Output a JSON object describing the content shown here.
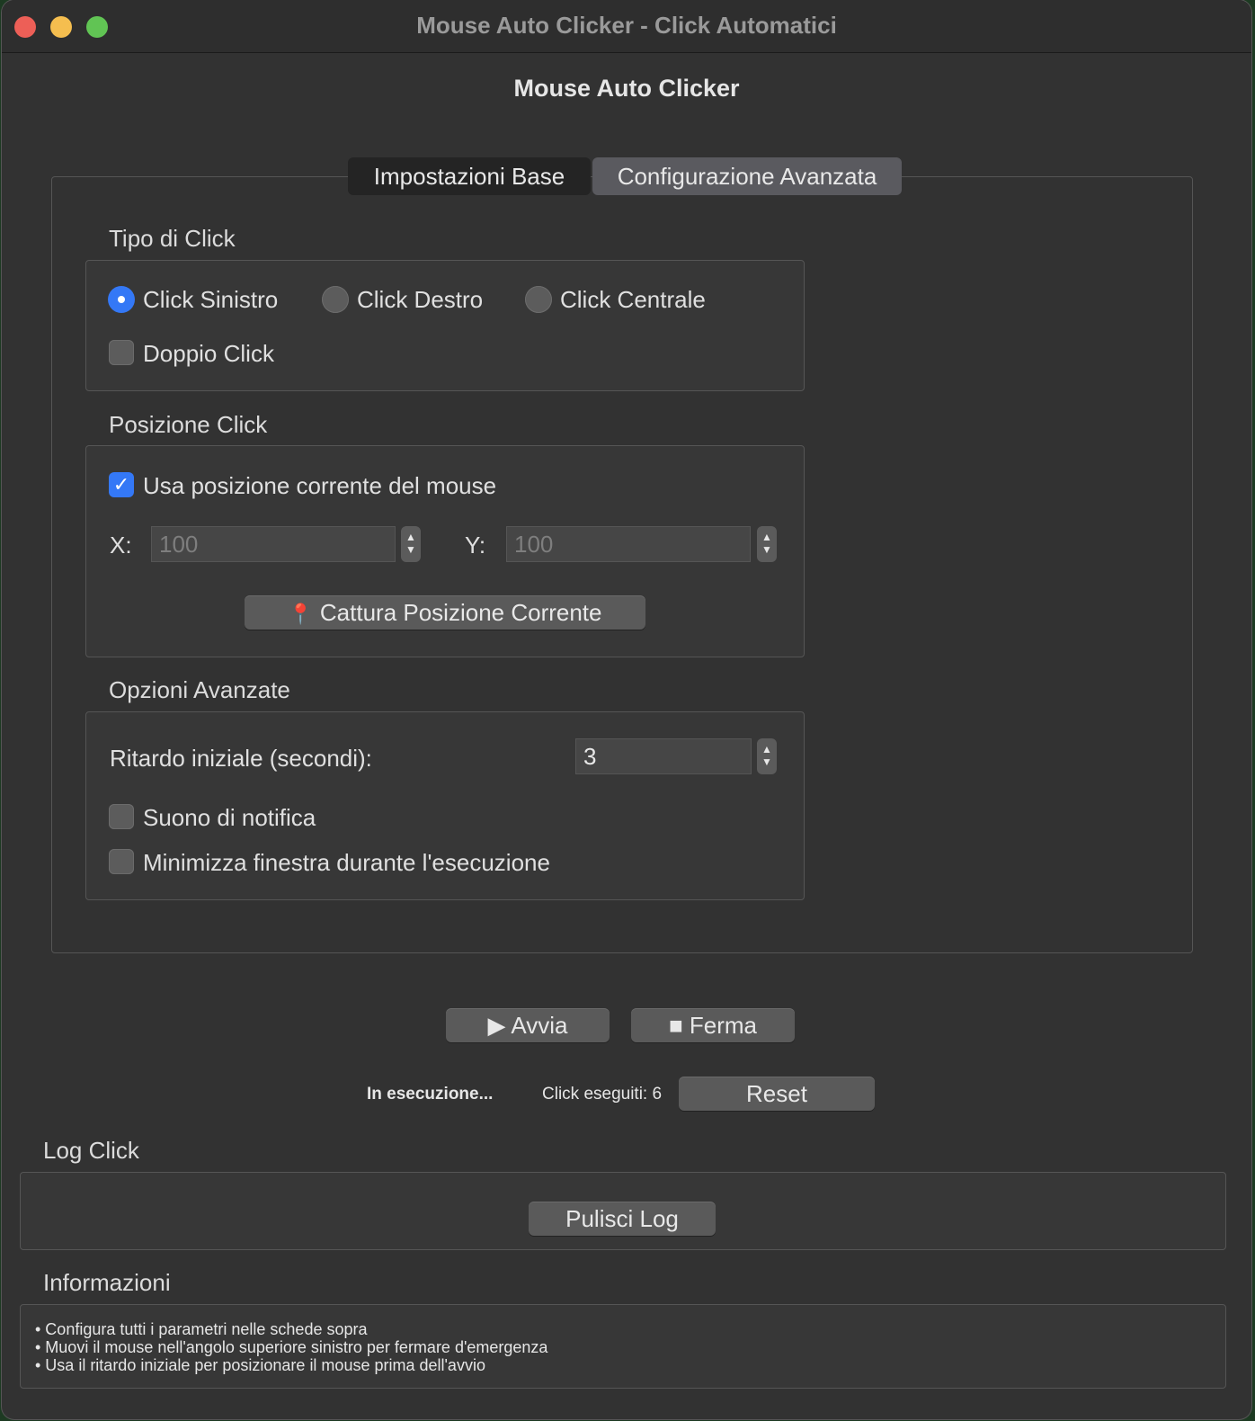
{
  "window": {
    "title": "Mouse Auto Clicker - Click Automatici",
    "app_title": "Mouse Auto Clicker"
  },
  "tabs": [
    {
      "label": "Impostazioni Base",
      "selected": false
    },
    {
      "label": "Configurazione Avanzata",
      "selected": true
    }
  ],
  "click_type": {
    "group_label": "Tipo di Click",
    "options": [
      {
        "label": "Click Sinistro",
        "selected": true
      },
      {
        "label": "Click Destro",
        "selected": false
      },
      {
        "label": "Click Centrale",
        "selected": false
      }
    ],
    "double_click": {
      "label": "Doppio Click",
      "checked": false
    }
  },
  "position": {
    "group_label": "Posizione Click",
    "use_current": {
      "label": "Usa posizione corrente del mouse",
      "checked": true
    },
    "x_label": "X:",
    "x_value": "100",
    "y_label": "Y:",
    "y_value": "100",
    "capture_button": "Cattura Posizione Corrente",
    "capture_icon": "pushpin-icon"
  },
  "advanced": {
    "group_label": "Opzioni Avanzate",
    "delay_label": "Ritardo iniziale (secondi):",
    "delay_value": "3",
    "sound": {
      "label": "Suono di notifica",
      "checked": false
    },
    "minimize": {
      "label": "Minimizza finestra durante l'esecuzione",
      "checked": false
    }
  },
  "controls": {
    "start_label": "▶ Avvia",
    "stop_label": "■ Ferma",
    "status": "In esecuzione...",
    "clicks_count": "Click eseguiti: 6",
    "reset_label": "Reset"
  },
  "log": {
    "label": "Log Click",
    "clear_button": "Pulisci Log"
  },
  "info": {
    "label": "Informazioni",
    "lines": [
      "• Configura tutti i parametri nelle schede sopra",
      "• Muovi il mouse nell'angolo superiore sinistro per fermare d'emergenza",
      "• Usa il ritardo iniziale per posizionare il mouse prima dell'avvio"
    ]
  },
  "colors": {
    "accent": "#3478f6",
    "window_bg": "#323232"
  }
}
